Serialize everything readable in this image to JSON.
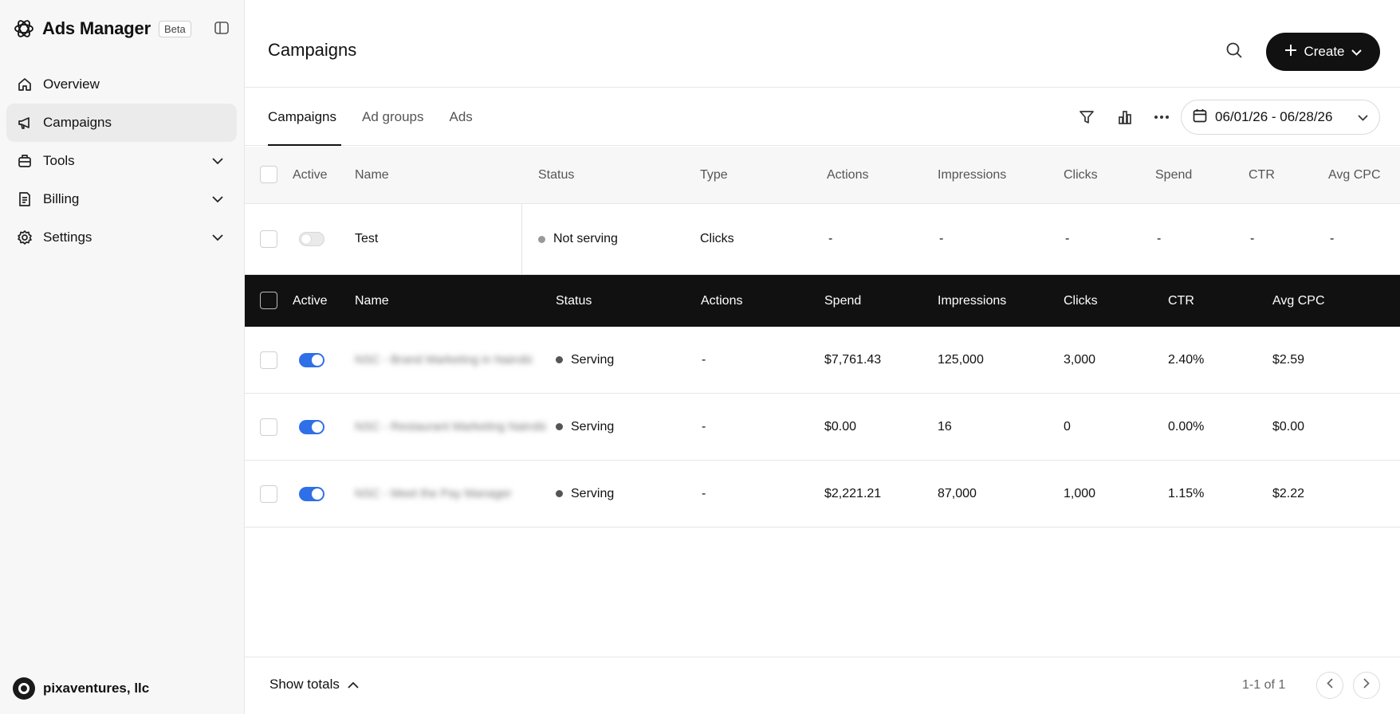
{
  "sidebar": {
    "app_name": "Ads Manager",
    "beta_label": "Beta",
    "items": [
      {
        "label": "Overview",
        "icon": "home-icon"
      },
      {
        "label": "Campaigns",
        "icon": "megaphone-icon",
        "active": true
      },
      {
        "label": "Tools",
        "icon": "toolbox-icon",
        "expandable": true
      },
      {
        "label": "Billing",
        "icon": "receipt-icon",
        "expandable": true
      },
      {
        "label": "Settings",
        "icon": "gear-icon",
        "expandable": true
      }
    ],
    "account_name": "pixaventures, llc"
  },
  "header": {
    "title": "Campaigns",
    "create_label": "Create"
  },
  "tabs": [
    {
      "label": "Campaigns",
      "active": true
    },
    {
      "label": "Ad groups"
    },
    {
      "label": "Ads"
    }
  ],
  "date_range": "06/01/26 - 06/28/26",
  "table1": {
    "headers": [
      "Active",
      "Name",
      "Status",
      "Type",
      "Actions",
      "Impressions",
      "Clicks",
      "Spend",
      "CTR",
      "Avg CPC"
    ],
    "rows": [
      {
        "active": false,
        "name": "Test",
        "status": "Not serving",
        "type": "Clicks",
        "actions": "-",
        "impressions": "-",
        "clicks": "-",
        "spend": "-",
        "ctr": "-",
        "avg_cpc": "-"
      }
    ]
  },
  "table2": {
    "headers": [
      "Active",
      "Name",
      "Status",
      "Actions",
      "Spend",
      "Impressions",
      "Clicks",
      "CTR",
      "Avg CPC"
    ],
    "rows": [
      {
        "active": true,
        "name": "NSC - Brand Marketing in Nairobi",
        "status": "Serving",
        "actions": "-",
        "spend": "$7,761.43",
        "impressions": "125,000",
        "clicks": "3,000",
        "ctr": "2.40%",
        "avg_cpc": "$2.59"
      },
      {
        "active": true,
        "name": "NSC - Restaurant Marketing Nairobi",
        "status": "Serving",
        "actions": "-",
        "spend": "$0.00",
        "impressions": "16",
        "clicks": "0",
        "ctr": "0.00%",
        "avg_cpc": "$0.00"
      },
      {
        "active": true,
        "name": "NSC - Meet the Pay Manager",
        "status": "Serving",
        "actions": "-",
        "spend": "$2,221.21",
        "impressions": "87,000",
        "clicks": "1,000",
        "ctr": "1.15%",
        "avg_cpc": "$2.22"
      }
    ]
  },
  "footer": {
    "show_totals_label": "Show totals",
    "pagination": "1-1 of 1"
  },
  "colors": {
    "toggle_on": "#2f6fe8",
    "status_serving": "#555555",
    "status_not_serving": "#999999",
    "header_dark": "#111111"
  }
}
